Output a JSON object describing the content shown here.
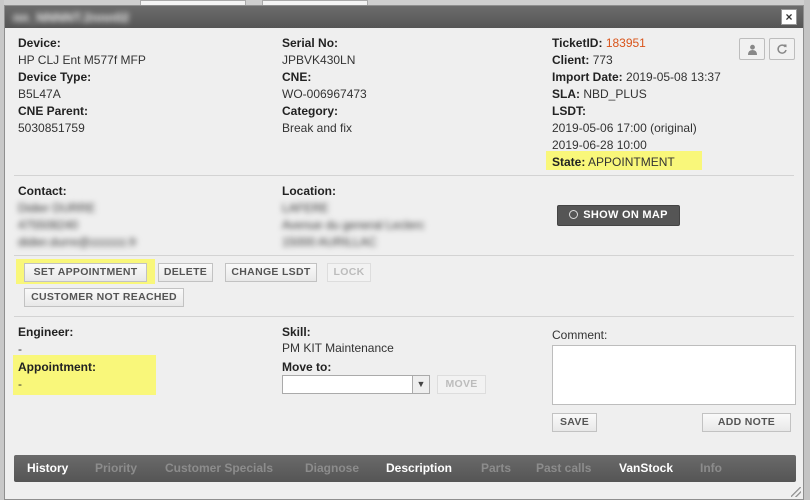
{
  "dialog": {
    "title": "nn_NNNNT.2nnn02",
    "close_label": "×"
  },
  "device": {
    "device_label": "Device:",
    "device_value": "HP CLJ Ent M577f MFP",
    "type_label": "Device Type:",
    "type_value": "B5L47A",
    "cne_parent_label": "CNE Parent:",
    "cne_parent_value": "5030851759"
  },
  "serial": {
    "serial_label": "Serial No:",
    "serial_value": "JPBVK430LN",
    "cne_label": "CNE:",
    "cne_value": "WO-006967473",
    "category_label": "Category:",
    "category_value": "Break and fix"
  },
  "ticket": {
    "id_label": "TicketID:",
    "id_value": "183951",
    "client_label": "Client:",
    "client_value": "773",
    "import_label": "Import Date:",
    "import_value": "2019-05-08 13:37",
    "sla_label": "SLA:",
    "sla_value": "NBD_PLUS",
    "lsdt_label": "LSDT:",
    "lsdt_original": "2019-05-06 17:00 (original)",
    "lsdt_current": "2019-06-28 10:00",
    "state_label": "State:",
    "state_value": "APPOINTMENT",
    "user_icon": "user-icon",
    "refresh_icon": "refresh-icon"
  },
  "contact": {
    "label": "Contact:",
    "lines": [
      "Didier DURRE",
      "475508240",
      "didier.durre@zzzzzz.fr"
    ]
  },
  "location": {
    "label": "Location:",
    "lines": [
      "LAFERE",
      "Avenue du general Leclerc",
      "15000 AURILLAC"
    ]
  },
  "map_button": {
    "label": "SHOW ON MAP",
    "icon": "map-pin-icon"
  },
  "actions": {
    "set_appointment": "SET APPOINTMENT",
    "delete": "DELETE",
    "change_lsdt": "CHANGE LSDT",
    "lock": "LOCK",
    "customer_not_reached": "CUSTOMER NOT REACHED"
  },
  "assignment": {
    "engineer_label": "Engineer:",
    "engineer_value": "-",
    "appointment_label": "Appointment:",
    "appointment_value": "-",
    "skill_label": "Skill:",
    "skill_value": "PM KIT Maintenance",
    "move_to_label": "Move to:",
    "move_to_value": "",
    "move_button": "MOVE",
    "comment_label": "Comment:",
    "comment_value": "",
    "save_button": "SAVE",
    "add_note_button": "ADD NOTE"
  },
  "tabs": [
    {
      "label": "History",
      "active": true
    },
    {
      "label": "Priority",
      "active": false
    },
    {
      "label": "Customer Specials",
      "active": false
    },
    {
      "label": "Diagnose",
      "active": false
    },
    {
      "label": "Description",
      "active": true
    },
    {
      "label": "Parts",
      "active": false
    },
    {
      "label": "Past calls",
      "active": false
    },
    {
      "label": "VanStock",
      "active": true
    },
    {
      "label": "Info",
      "active": false
    }
  ],
  "colors": {
    "highlight": "#f9f77a",
    "ticket_id": "#d9541a",
    "tab_bar": "#5c5c5c"
  }
}
